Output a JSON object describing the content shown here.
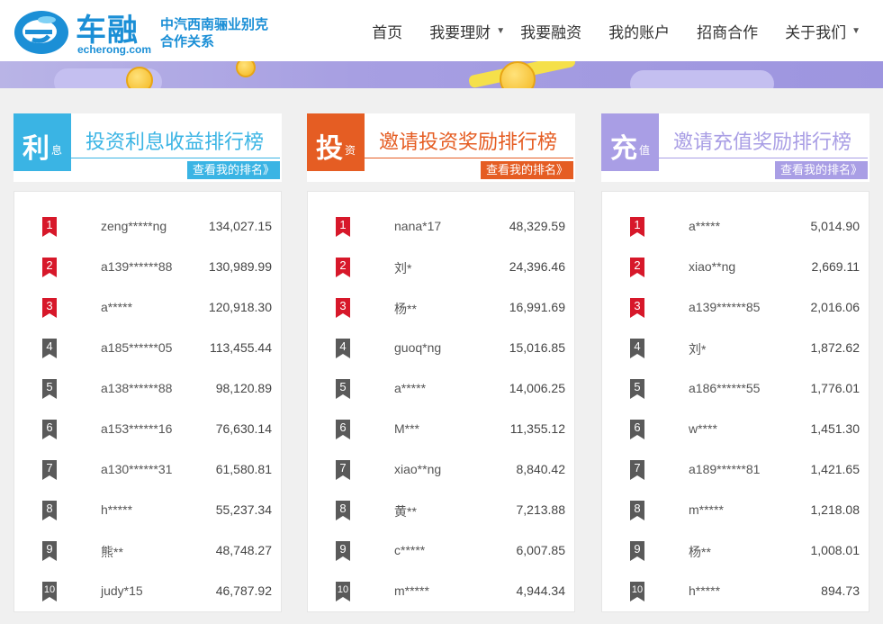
{
  "header": {
    "logo_name": "车融",
    "logo_domain": "echerong.com",
    "slogan_line1": "中汽西南骊业别克",
    "slogan_line2": "合作关系",
    "nav": [
      {
        "label": "首页"
      },
      {
        "label": "我要理财"
      },
      {
        "label": "我要融资"
      },
      {
        "label": "我的账户"
      },
      {
        "label": "招商合作"
      },
      {
        "label": "关于我们"
      }
    ]
  },
  "colors": {
    "interest": "#3ab4e4",
    "invest": "#e55d23",
    "recharge": "#a99ee5",
    "rank_top": "#d7182a",
    "rank_other": "#5a5a5a"
  },
  "panels": [
    {
      "badge_big": "利",
      "badge_small": "息",
      "title": "投资利息收益排行榜",
      "button": "查看我的排名》",
      "rows": [
        {
          "rank": "1",
          "user": "zeng*****ng",
          "amount": "134,027.15"
        },
        {
          "rank": "2",
          "user": "a139******88",
          "amount": "130,989.99"
        },
        {
          "rank": "3",
          "user": "a*****",
          "amount": "120,918.30"
        },
        {
          "rank": "4",
          "user": "a185******05",
          "amount": "113,455.44"
        },
        {
          "rank": "5",
          "user": "a138******88",
          "amount": "98,120.89"
        },
        {
          "rank": "6",
          "user": "a153******16",
          "amount": "76,630.14"
        },
        {
          "rank": "7",
          "user": "a130******31",
          "amount": "61,580.81"
        },
        {
          "rank": "8",
          "user": "h*****",
          "amount": "55,237.34"
        },
        {
          "rank": "9",
          "user": "熊**",
          "amount": "48,748.27"
        },
        {
          "rank": "10",
          "user": "judy*15",
          "amount": "46,787.92"
        }
      ]
    },
    {
      "badge_big": "投",
      "badge_small": "资",
      "title": "邀请投资奖励排行榜",
      "button": "查看我的排名》",
      "rows": [
        {
          "rank": "1",
          "user": "nana*17",
          "amount": "48,329.59"
        },
        {
          "rank": "2",
          "user": "刘*",
          "amount": "24,396.46"
        },
        {
          "rank": "3",
          "user": "杨**",
          "amount": "16,991.69"
        },
        {
          "rank": "4",
          "user": "guoq*ng",
          "amount": "15,016.85"
        },
        {
          "rank": "5",
          "user": "a*****",
          "amount": "14,006.25"
        },
        {
          "rank": "6",
          "user": "M***",
          "amount": "11,355.12"
        },
        {
          "rank": "7",
          "user": "xiao**ng",
          "amount": "8,840.42"
        },
        {
          "rank": "8",
          "user": "黄**",
          "amount": "7,213.88"
        },
        {
          "rank": "9",
          "user": "c*****",
          "amount": "6,007.85"
        },
        {
          "rank": "10",
          "user": "m*****",
          "amount": "4,944.34"
        }
      ]
    },
    {
      "badge_big": "充",
      "badge_small": "值",
      "title": "邀请充值奖励排行榜",
      "button": "查看我的排名》",
      "rows": [
        {
          "rank": "1",
          "user": "a*****",
          "amount": "5,014.90"
        },
        {
          "rank": "2",
          "user": "xiao**ng",
          "amount": "2,669.11"
        },
        {
          "rank": "3",
          "user": "a139******85",
          "amount": "2,016.06"
        },
        {
          "rank": "4",
          "user": "刘*",
          "amount": "1,872.62"
        },
        {
          "rank": "5",
          "user": "a186******55",
          "amount": "1,776.01"
        },
        {
          "rank": "6",
          "user": "w****",
          "amount": "1,451.30"
        },
        {
          "rank": "7",
          "user": "a189******81",
          "amount": "1,421.65"
        },
        {
          "rank": "8",
          "user": "m*****",
          "amount": "1,218.08"
        },
        {
          "rank": "9",
          "user": "杨**",
          "amount": "1,008.01"
        },
        {
          "rank": "10",
          "user": "h*****",
          "amount": "894.73"
        }
      ]
    }
  ]
}
